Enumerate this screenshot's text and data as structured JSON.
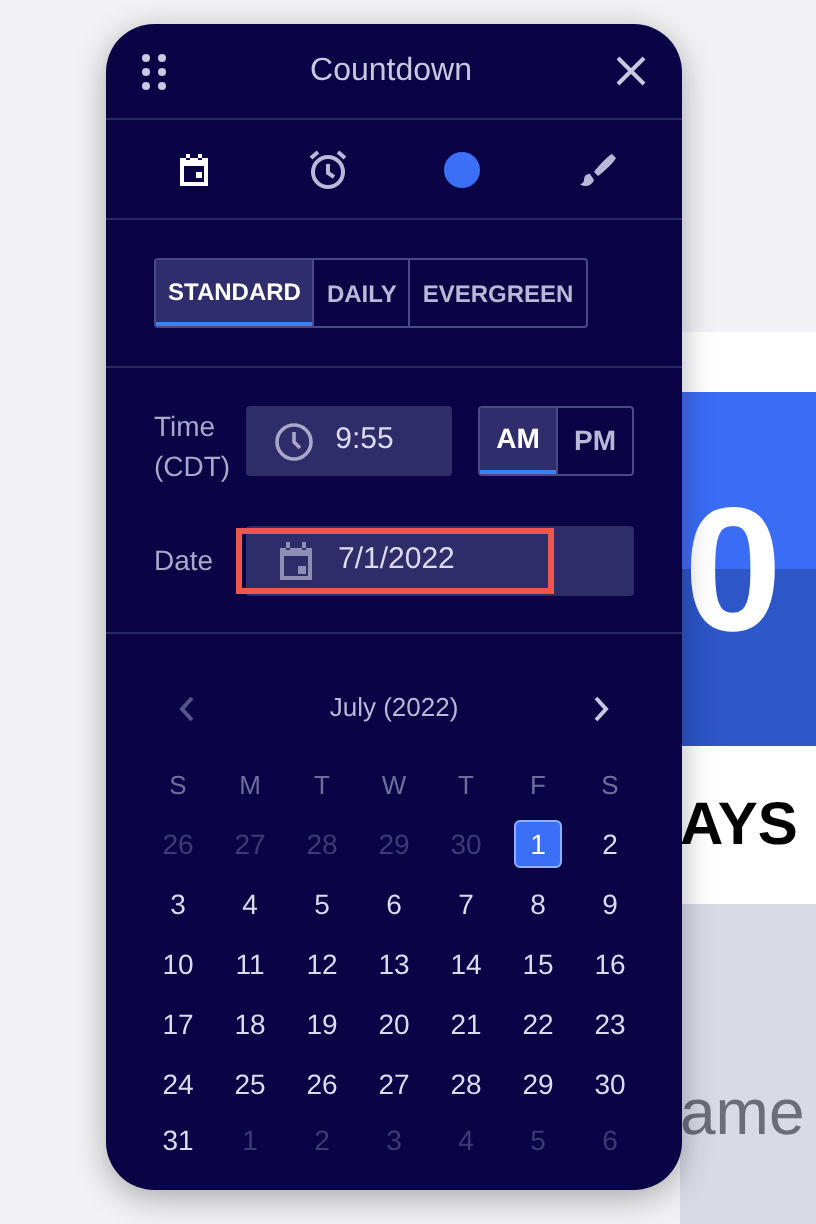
{
  "panel": {
    "title": "Countdown"
  },
  "icon_tabs": [
    {
      "kind": "calendar",
      "selected": true
    },
    {
      "kind": "alarm",
      "selected": false
    },
    {
      "kind": "color",
      "selected": false,
      "color": "#3b6ff6"
    },
    {
      "kind": "brush",
      "selected": false
    }
  ],
  "modes": [
    {
      "label": "STANDARD",
      "selected": true
    },
    {
      "label": "DAILY",
      "selected": false
    },
    {
      "label": "EVERGREEN",
      "selected": false
    }
  ],
  "time": {
    "label": "Time\n(CDT)",
    "value": "9:55",
    "periods": [
      {
        "label": "AM",
        "selected": true
      },
      {
        "label": "PM",
        "selected": false
      }
    ]
  },
  "date": {
    "label": "Date",
    "value": "7/1/2022",
    "highlighted": true
  },
  "calendar": {
    "month": "July (2022)",
    "weekdays": [
      "S",
      "M",
      "T",
      "W",
      "T",
      "F",
      "S"
    ],
    "days": [
      {
        "label": "26",
        "outside": true,
        "selected": false
      },
      {
        "label": "27",
        "outside": true,
        "selected": false
      },
      {
        "label": "28",
        "outside": true,
        "selected": false
      },
      {
        "label": "29",
        "outside": true,
        "selected": false
      },
      {
        "label": "30",
        "outside": true,
        "selected": false
      },
      {
        "label": "1",
        "outside": false,
        "selected": true
      },
      {
        "label": "2",
        "outside": false,
        "selected": false
      },
      {
        "label": "3",
        "outside": false,
        "selected": false
      },
      {
        "label": "4",
        "outside": false,
        "selected": false
      },
      {
        "label": "5",
        "outside": false,
        "selected": false
      },
      {
        "label": "6",
        "outside": false,
        "selected": false
      },
      {
        "label": "7",
        "outside": false,
        "selected": false
      },
      {
        "label": "8",
        "outside": false,
        "selected": false
      },
      {
        "label": "9",
        "outside": false,
        "selected": false
      },
      {
        "label": "10",
        "outside": false,
        "selected": false
      },
      {
        "label": "11",
        "outside": false,
        "selected": false
      },
      {
        "label": "12",
        "outside": false,
        "selected": false
      },
      {
        "label": "13",
        "outside": false,
        "selected": false
      },
      {
        "label": "14",
        "outside": false,
        "selected": false
      },
      {
        "label": "15",
        "outside": false,
        "selected": false
      },
      {
        "label": "16",
        "outside": false,
        "selected": false
      },
      {
        "label": "17",
        "outside": false,
        "selected": false
      },
      {
        "label": "18",
        "outside": false,
        "selected": false
      },
      {
        "label": "19",
        "outside": false,
        "selected": false
      },
      {
        "label": "20",
        "outside": false,
        "selected": false
      },
      {
        "label": "21",
        "outside": false,
        "selected": false
      },
      {
        "label": "22",
        "outside": false,
        "selected": false
      },
      {
        "label": "23",
        "outside": false,
        "selected": false
      },
      {
        "label": "24",
        "outside": false,
        "selected": false
      },
      {
        "label": "25",
        "outside": false,
        "selected": false
      },
      {
        "label": "26",
        "outside": false,
        "selected": false
      },
      {
        "label": "27",
        "outside": false,
        "selected": false
      },
      {
        "label": "28",
        "outside": false,
        "selected": false
      },
      {
        "label": "29",
        "outside": false,
        "selected": false
      },
      {
        "label": "30",
        "outside": false,
        "selected": false
      },
      {
        "label": "31",
        "outside": false,
        "selected": false
      },
      {
        "label": "1",
        "outside": true,
        "selected": false
      },
      {
        "label": "2",
        "outside": true,
        "selected": false
      },
      {
        "label": "3",
        "outside": true,
        "selected": false
      },
      {
        "label": "4",
        "outside": true,
        "selected": false
      },
      {
        "label": "5",
        "outside": true,
        "selected": false
      },
      {
        "label": "6",
        "outside": true,
        "selected": false
      }
    ]
  },
  "background": {
    "counter_digit": "0",
    "unit": "AYS",
    "name_hint": "ame"
  }
}
